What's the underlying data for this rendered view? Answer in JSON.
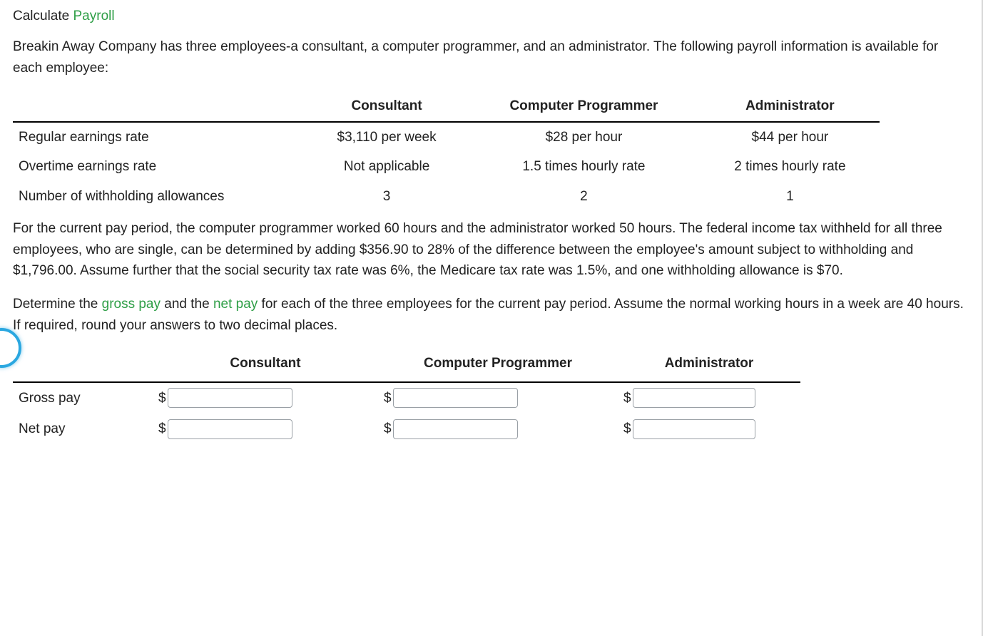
{
  "title": {
    "prefix": "Calculate ",
    "keyword": "Payroll"
  },
  "intro": "Breakin Away Company has three employees-a consultant, a computer programmer, and an administrator. The following payroll information is available for each employee:",
  "info_table": {
    "headers": {
      "blank": "",
      "c1": "Consultant",
      "c2": "Computer Programmer",
      "c3": "Administrator"
    },
    "rows": [
      {
        "label": "Regular earnings rate",
        "c1": "$3,110 per week",
        "c2": "$28 per hour",
        "c3": "$44 per hour"
      },
      {
        "label": "Overtime earnings rate",
        "c1": "Not applicable",
        "c2": "1.5 times hourly rate",
        "c3": "2 times hourly rate"
      },
      {
        "label": "Number of withholding allowances",
        "c1": "3",
        "c2": "2",
        "c3": "1"
      }
    ]
  },
  "paragraph2": "For the current pay period, the computer programmer worked 60 hours and the administrator worked 50 hours. The federal income tax withheld for all three employees, who are single, can be determined by adding $356.90 to 28% of the difference between the employee's amount subject to withholding and $1,796.00. Assume further that the social security tax rate was 6%, the Medicare tax rate was 1.5%, and one withholding allowance is $70.",
  "instruction": {
    "p1": "Determine the ",
    "kw1": "gross pay",
    "p2": " and the ",
    "kw2": "net pay",
    "p3": " for each of the three employees for the current pay period. Assume the normal working hours in a week are 40 hours. If required, round your answers to two decimal places."
  },
  "answer_table": {
    "headers": {
      "blank": "",
      "c1": "Consultant",
      "c2": "Computer Programmer",
      "c3": "Administrator"
    },
    "rows": [
      {
        "label": "Gross pay"
      },
      {
        "label": "Net pay"
      }
    ],
    "currency": "$"
  }
}
